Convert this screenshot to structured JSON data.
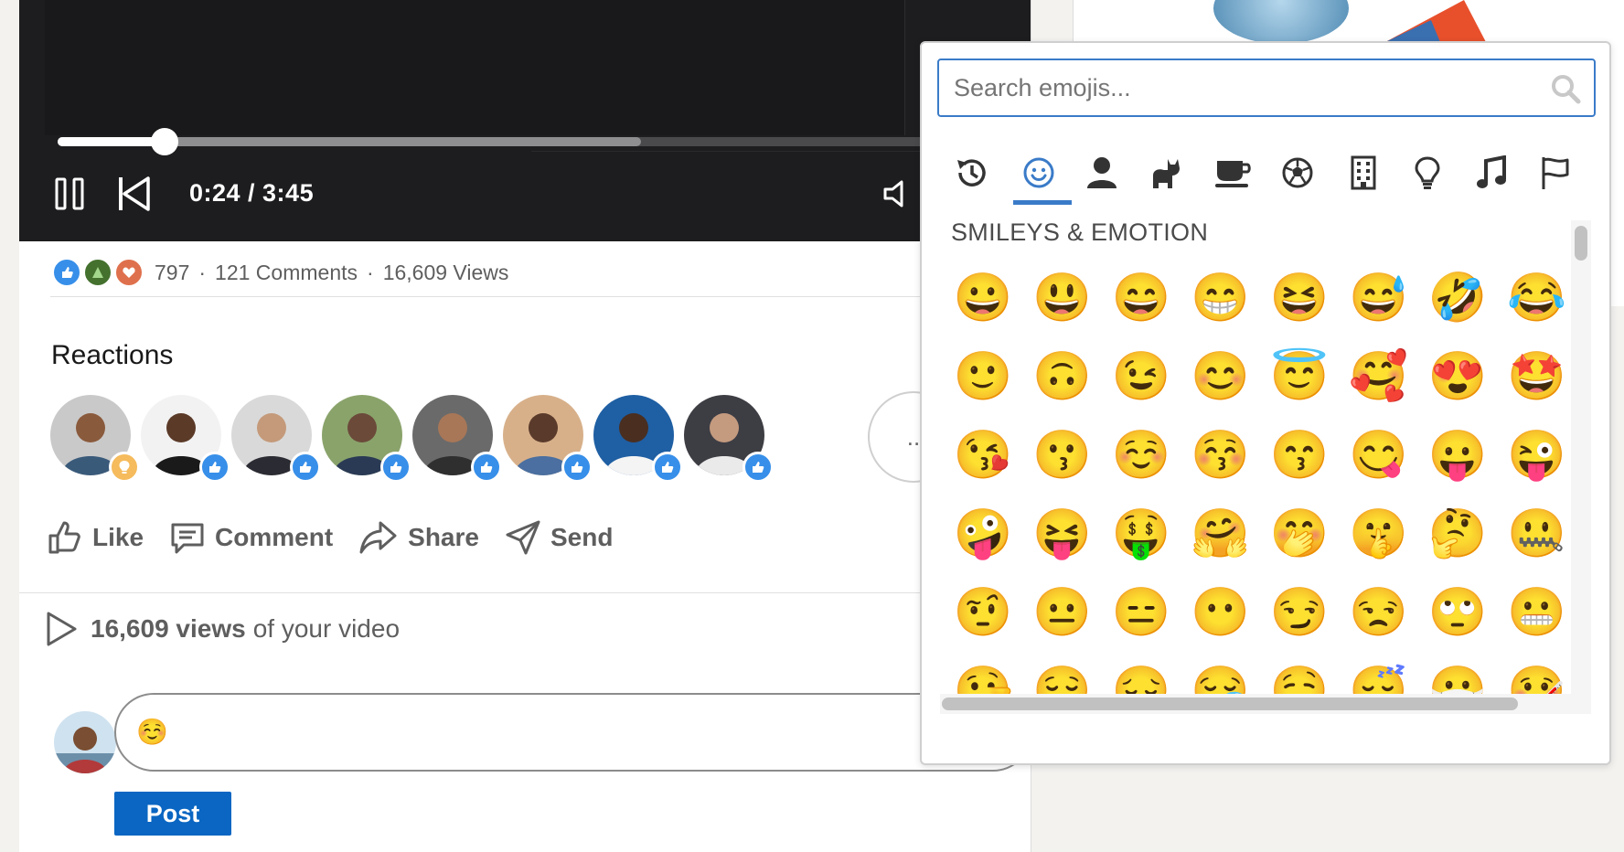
{
  "video": {
    "time_display": "0:24 / 3:45",
    "progress_fraction": 0.11,
    "buffered_fraction": 0.6
  },
  "social": {
    "reaction_count": "797",
    "comments": "121 Comments",
    "views": "16,609 Views",
    "separator": "·"
  },
  "reactions": {
    "title": "Reactions",
    "more_label": "..",
    "people": [
      {
        "badge": "insightful"
      },
      {
        "badge": "like"
      },
      {
        "badge": "like"
      },
      {
        "badge": "like"
      },
      {
        "badge": "like"
      },
      {
        "badge": "like"
      },
      {
        "badge": "like"
      },
      {
        "badge": "like"
      }
    ]
  },
  "actions": {
    "like": "Like",
    "comment": "Comment",
    "share": "Share",
    "send": "Send"
  },
  "views_row": {
    "count": "16,609 views",
    "suffix": "of your video"
  },
  "comment_box": {
    "value": "☺️"
  },
  "post_button": "Post",
  "emoji_picker": {
    "search_placeholder": "Search emojis...",
    "categories": [
      "recent-icon",
      "smiley-icon",
      "person-icon",
      "animal-icon",
      "food-icon",
      "activity-icon",
      "building-icon",
      "lightbulb-icon",
      "music-icon",
      "flag-icon"
    ],
    "active_category": 1,
    "section_title": "SMILEYS & EMOTION",
    "emojis": [
      "😀",
      "😃",
      "😄",
      "😁",
      "😆",
      "😅",
      "🤣",
      "😂",
      "🙂",
      "🙃",
      "😉",
      "😊",
      "😇",
      "🥰",
      "😍",
      "🤩",
      "😘",
      "😗",
      "☺️",
      "😚",
      "😙",
      "😋",
      "😛",
      "😜",
      "🤪",
      "😝",
      "🤑",
      "🤗",
      "🤭",
      "🤫",
      "🤔",
      "🤐",
      "🤨",
      "😐",
      "😑",
      "😶",
      "😏",
      "😒",
      "🙄",
      "😬",
      "🤥",
      "😌",
      "😔",
      "😪",
      "🤤",
      "😴",
      "😷",
      "🤒"
    ]
  },
  "colors": {
    "accent": "#3a7bc8",
    "post_blue": "#0a66c2",
    "like_blue": "#378fe9",
    "insight_yellow": "#f5bb5c"
  }
}
